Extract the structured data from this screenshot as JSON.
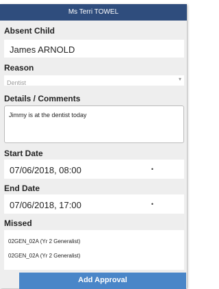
{
  "header": {
    "title": "Ms Terri TOWEL"
  },
  "absent_child": {
    "label": "Absent Child",
    "value": "James ARNOLD"
  },
  "reason": {
    "label": "Reason",
    "selected": "Dentist"
  },
  "details": {
    "label": "Details / Comments",
    "value": "Jimmy is at the dentist today"
  },
  "start_date": {
    "label": "Start Date",
    "value": "07/06/2018, 08:00"
  },
  "end_date": {
    "label": "End Date",
    "value": "07/06/2018, 17:00"
  },
  "missed": {
    "label": "Missed",
    "items": [
      "02GEN_02A (Yr 2 Generalist)",
      "02GEN_02A (Yr 2 Generalist)"
    ]
  },
  "actions": {
    "add_approval": "Add Approval"
  },
  "colors": {
    "header": "#2f4d7d",
    "button": "#4a86c8",
    "panel": "#eeeeee"
  }
}
